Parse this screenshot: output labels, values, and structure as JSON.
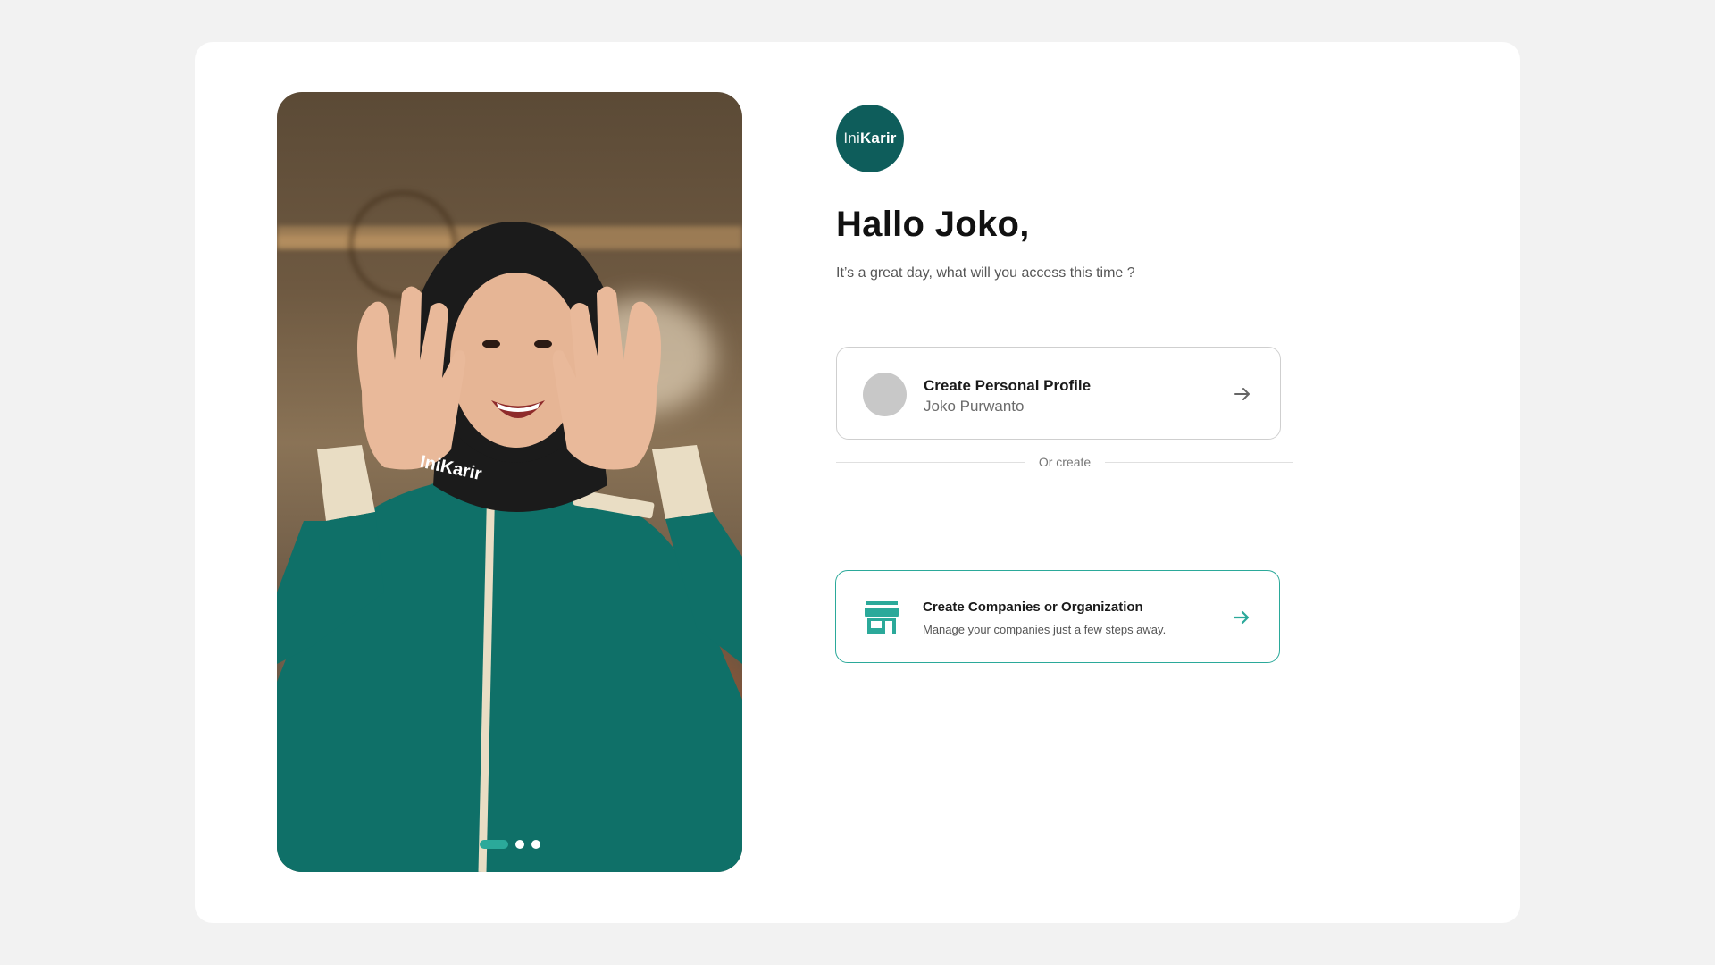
{
  "brand": {
    "logo_light": "Ini",
    "logo_bold": "Karir",
    "color_primary": "#0e5d5b",
    "color_accent": "#2ba99a"
  },
  "hero": {
    "shirt_text": "IniKarir",
    "pager": {
      "total": 3,
      "active": 1
    }
  },
  "greeting": {
    "title": "Hallo Joko,",
    "subtitle": "It’s a great day, what will you access this time ?"
  },
  "personal_option": {
    "title": "Create Personal Profile",
    "subtitle": "Joko Purwanto",
    "icon": "arrow-right-icon"
  },
  "divider": {
    "label": "Or create"
  },
  "company_option": {
    "title": "Create Companies or Organization",
    "subtitle": "Manage your companies just a few steps away.",
    "icon": "store-icon",
    "arrow_icon": "arrow-right-icon"
  }
}
